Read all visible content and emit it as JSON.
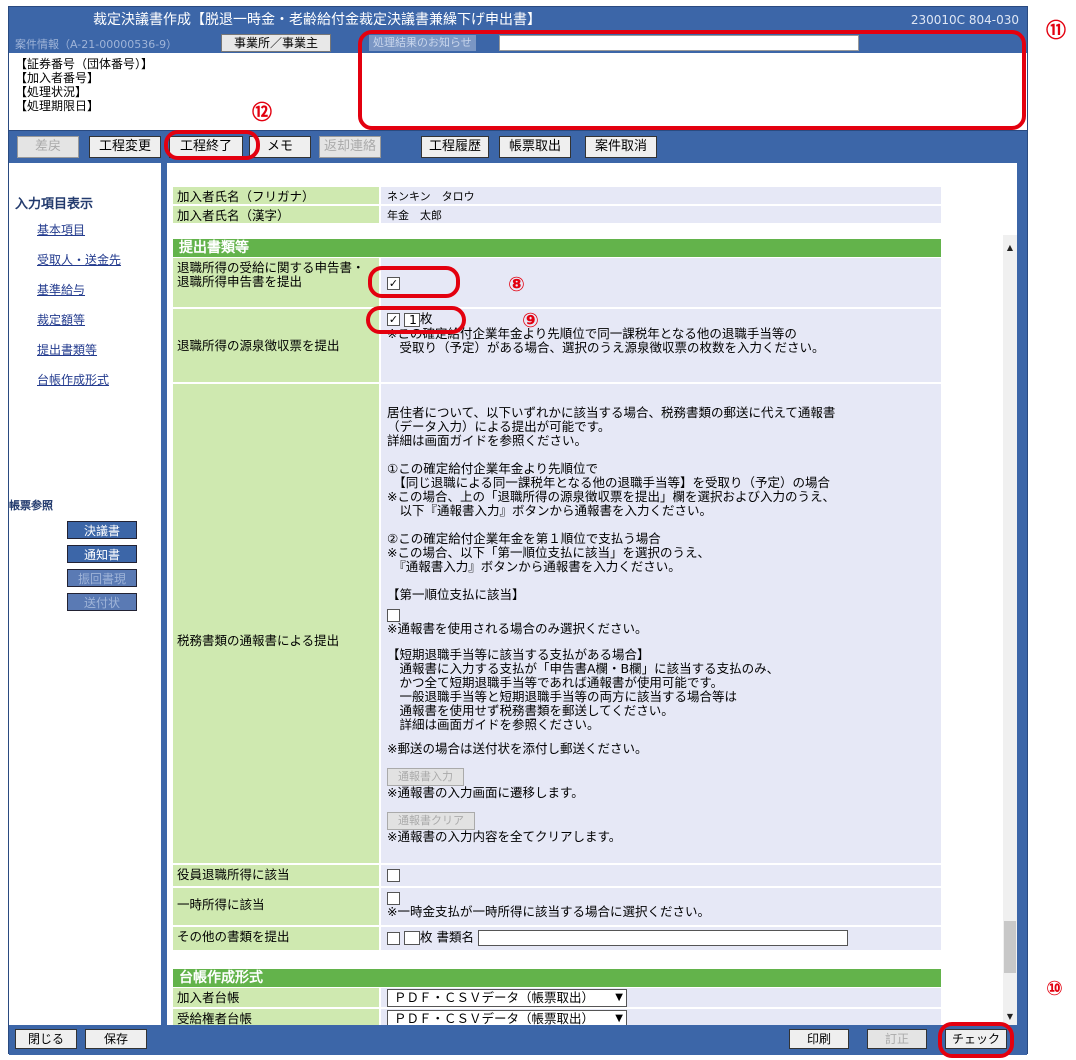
{
  "window": {
    "title": "裁定決議書作成【脱退一時金・老齢給付金裁定決議書兼繰下げ申出書】",
    "screen_code": "230010C 804-030",
    "case_info": "案件情報（A-21-00000536-9）",
    "office_button": "事業所／事業主",
    "notice_label": "処理結果のお知らせ"
  },
  "status_lines": [
    "【証券番号（団体番号）】",
    "【加入者番号】",
    "【処理状況】",
    "【処理期限日】"
  ],
  "toolbar": {
    "back": "差戻",
    "change": "工程変更",
    "finish": "工程終了",
    "memo": "メモ",
    "return_contact": "返却連絡",
    "history": "工程履歴",
    "form_get": "帳票取出",
    "cancel": "案件取消"
  },
  "nav": {
    "heading": "入力項目表示",
    "links": [
      "基本項目",
      "受取人・送金先",
      "基準給与",
      "裁定額等",
      "提出書類等",
      "台帳作成形式"
    ],
    "ref_heading": "帳票参照",
    "ref_buttons": [
      "決議書",
      "通知書",
      "振回書現",
      "送付状"
    ]
  },
  "fields": {
    "kana_label": "加入者氏名（フリガナ）",
    "kana_value": "ネンキン　タロウ",
    "kanji_label": "加入者氏名（漢字）",
    "kanji_value": "年金　太郎"
  },
  "section_docs": {
    "title": "提出書類等",
    "retire_decl_label": "退職所得の受給に関する申告書・退職所得申告書を提出",
    "withhold_label": "退職所得の源泉徴収票を提出",
    "withhold_count": "1",
    "sheet_unit": "枚",
    "withhold_note": "※この確定給付企業年金より先順位で同一課税年となる他の退職手当等の\n　受取り（予定）がある場合、選択のうえ源泉徴収票の枚数を入力ください。",
    "tax_label": "税務書類の通報書による提出",
    "tax_note1": "居住者について、以下いずれかに該当する場合、税務書類の郵送に代えて通報書\n（データ入力）による提出が可能です。\n詳細は画面ガイドを参照ください。",
    "tax_note2": "①この確定給付企業年金より先順位で\n　【同じ退職による同一課税年となる他の退職手当等】を受取り（予定）の場合\n※この場合、上の「退職所得の源泉徴収票を提出」欄を選択および入力のうえ、\n　以下『通報書入力』ボタンから通報書を入力ください。",
    "tax_note3": "②この確定給付企業年金を第１順位で支払う場合\n※この場合、以下「第一順位支払に該当」を選択のうえ、\n　『通報書入力』ボタンから通報書を入力ください。",
    "first_pay_label": "【第一順位支払に該当】",
    "first_pay_note": "※通報書を使用される場合のみ選択ください。",
    "short_note": "【短期退職手当等に該当する支払がある場合】\n　通報書に入力する支払が「申告書A欄・B欄」に該当する支払のみ、\n　かつ全て短期退職手当等であれば通報書が使用可能です。\n　一般退職手当等と短期退職手当等の両方に該当する場合等は\n　通報書を使用せず税務書類を郵送してください。\n　詳細は画面ガイドを参照ください。",
    "mail_note": "※郵送の場合は送付状を添付し郵送ください。",
    "input_btn": "通報書入力",
    "input_note": "※通報書の入力画面に遷移します。",
    "clear_btn": "通報書クリア",
    "clear_note": "※通報書の入力内容を全てクリアします。",
    "officer_label": "役員退職所得に該当",
    "temp_label": "一時所得に該当",
    "temp_note": "※一時金支払が一時所得に該当する場合に選択ください。",
    "other_label": "その他の書類を提出",
    "doc_name_label": "書類名"
  },
  "section_ledger": {
    "title": "台帳作成形式",
    "member_label": "加入者台帳",
    "member_value": "ＰＤＦ・ＣＳＶデータ（帳票取出）",
    "recipient_label": "受給権者台帳",
    "recipient_value": "ＰＤＦ・ＣＳＶデータ（帳票取出）"
  },
  "bottom": {
    "close": "閉じる",
    "save": "保存",
    "print": "印刷",
    "correct": "訂正",
    "check": "チェック"
  },
  "annotations": {
    "n8": "⑧",
    "n9": "⑨",
    "n10": "⑩",
    "n11": "⑪",
    "n12": "⑫"
  },
  "colors": {
    "frame": "#3c66a8",
    "label_bg": "#cfe9b0",
    "value_bg": "#e6e8f6",
    "section": "#63b34b",
    "highlight": "#e3000f"
  }
}
